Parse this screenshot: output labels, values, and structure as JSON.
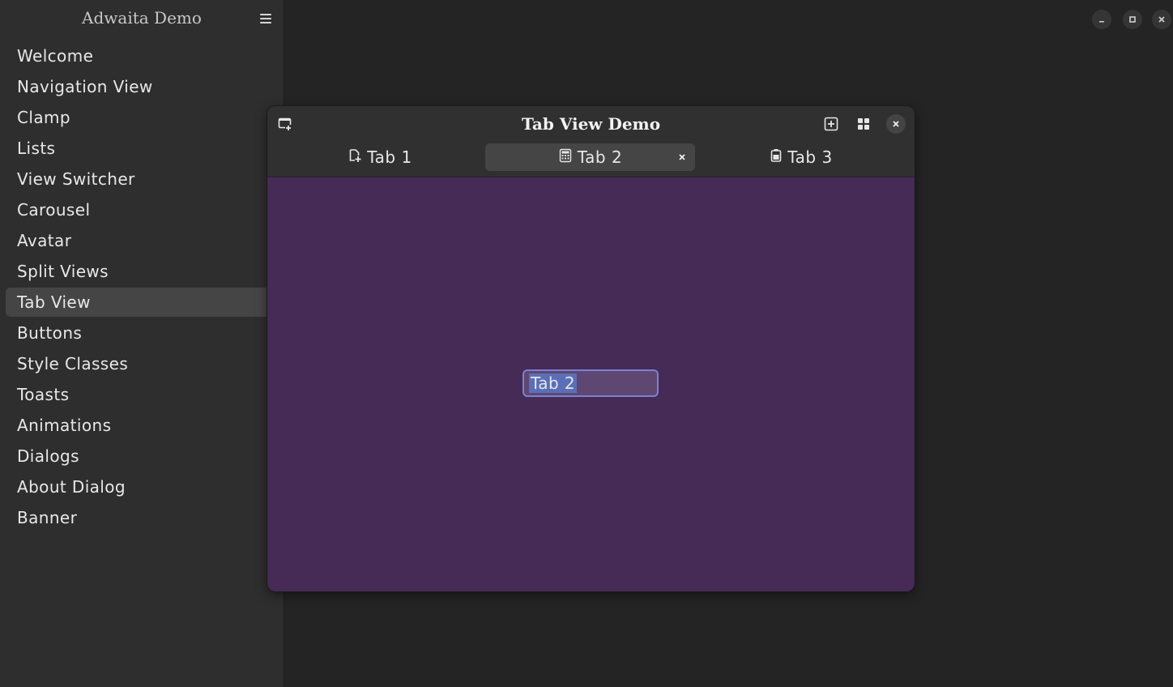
{
  "sidebar": {
    "title": "Adwaita Demo",
    "menu_icon": "hamburger-menu-icon",
    "items": [
      {
        "label": "Welcome"
      },
      {
        "label": "Navigation View"
      },
      {
        "label": "Clamp"
      },
      {
        "label": "Lists"
      },
      {
        "label": "View Switcher"
      },
      {
        "label": "Carousel"
      },
      {
        "label": "Avatar"
      },
      {
        "label": "Split Views"
      },
      {
        "label": "Tab View",
        "active": true
      },
      {
        "label": "Buttons"
      },
      {
        "label": "Style Classes"
      },
      {
        "label": "Toasts"
      },
      {
        "label": "Animations"
      },
      {
        "label": "Dialogs"
      },
      {
        "label": "About Dialog"
      },
      {
        "label": "Banner"
      }
    ]
  },
  "window_controls": [
    "minimize-icon",
    "maximize-icon",
    "close-icon"
  ],
  "dialog": {
    "title": "Tab View Demo",
    "tabs": [
      {
        "label": "Tab 1",
        "icon": "document-new-icon"
      },
      {
        "label": "Tab 2",
        "icon": "calculator-icon",
        "active": true
      },
      {
        "label": "Tab 3",
        "icon": "battery-icon"
      }
    ],
    "entry_value": "Tab 2"
  },
  "colors": {
    "content_bg": "#452b55",
    "header_bg": "#303030",
    "sidebar_bg": "#2e2e2e",
    "entry_border": "#7c80d4",
    "selection": "#5b6fb8"
  }
}
